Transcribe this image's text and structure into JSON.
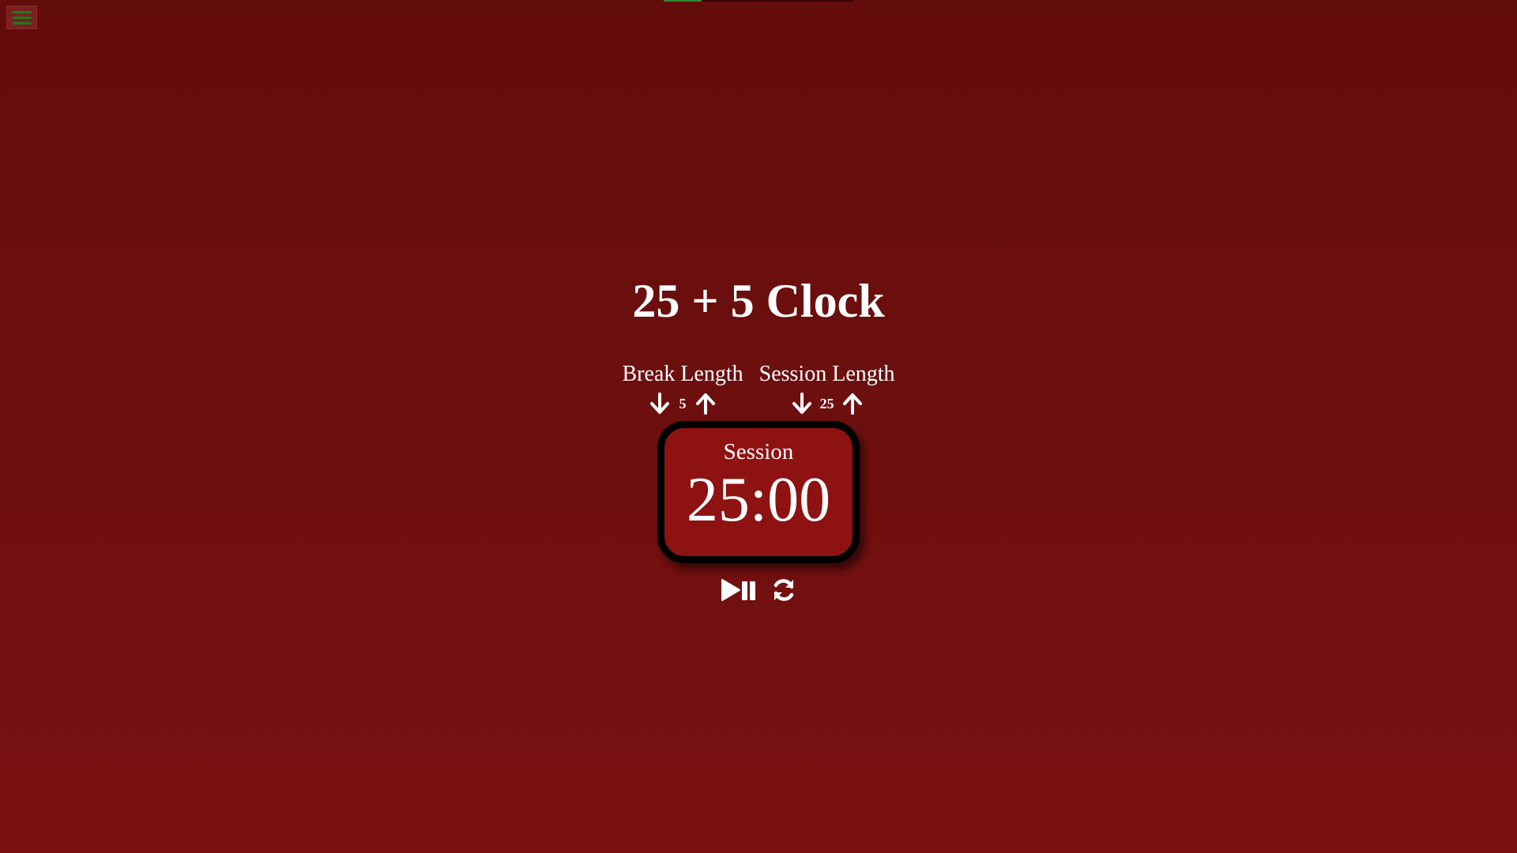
{
  "app": {
    "title": "25 + 5 Clock"
  },
  "menu": {
    "icon": "menu-icon",
    "icon_color": "#1f7a1f"
  },
  "progress": {
    "fraction": 0.2,
    "color": "#2e8b2e"
  },
  "break": {
    "label": "Break Length",
    "value": "5",
    "decrement_icon": "arrow-down-icon",
    "increment_icon": "arrow-up-icon"
  },
  "session": {
    "label": "Session Length",
    "value": "25",
    "decrement_icon": "arrow-down-icon",
    "increment_icon": "arrow-up-icon"
  },
  "timer": {
    "label": "Session",
    "time_left": "25:00"
  },
  "controls": {
    "start_stop_icon": "play-pause-icon",
    "reset_icon": "refresh-icon"
  },
  "colors": {
    "background": "#6d0f0f",
    "timer_face": "#8f1212",
    "timer_border": "#000000",
    "text": "#ffffff"
  }
}
